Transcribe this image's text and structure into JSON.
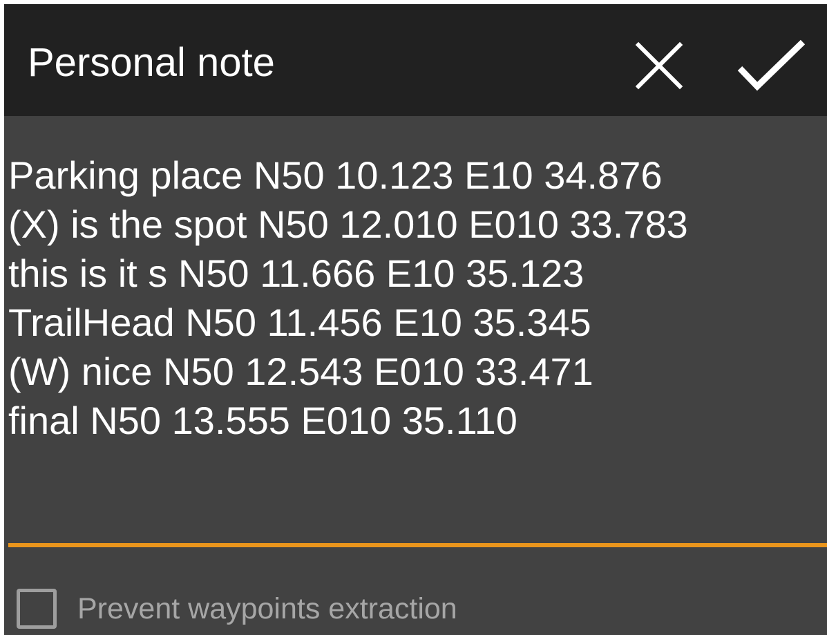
{
  "dialog": {
    "title": "Personal note",
    "cancel_icon": "close-icon",
    "confirm_icon": "check-icon",
    "accent_color": "#ea951c",
    "toolbar_color": "#212121",
    "background_color": "#424242"
  },
  "note": {
    "lines": [
      "Parking place N50 10.123 E10 34.876",
      "(X) is the spot N50 12.010 E010 33.783",
      "this is it s N50 11.666 E10 35.123",
      "TrailHead N50 11.456 E10 35.345",
      "(W) nice N50 12.543 E010 33.471",
      "final N50 13.555 E010 35.110"
    ]
  },
  "option": {
    "label": "Prevent waypoints extraction",
    "checked": false
  }
}
